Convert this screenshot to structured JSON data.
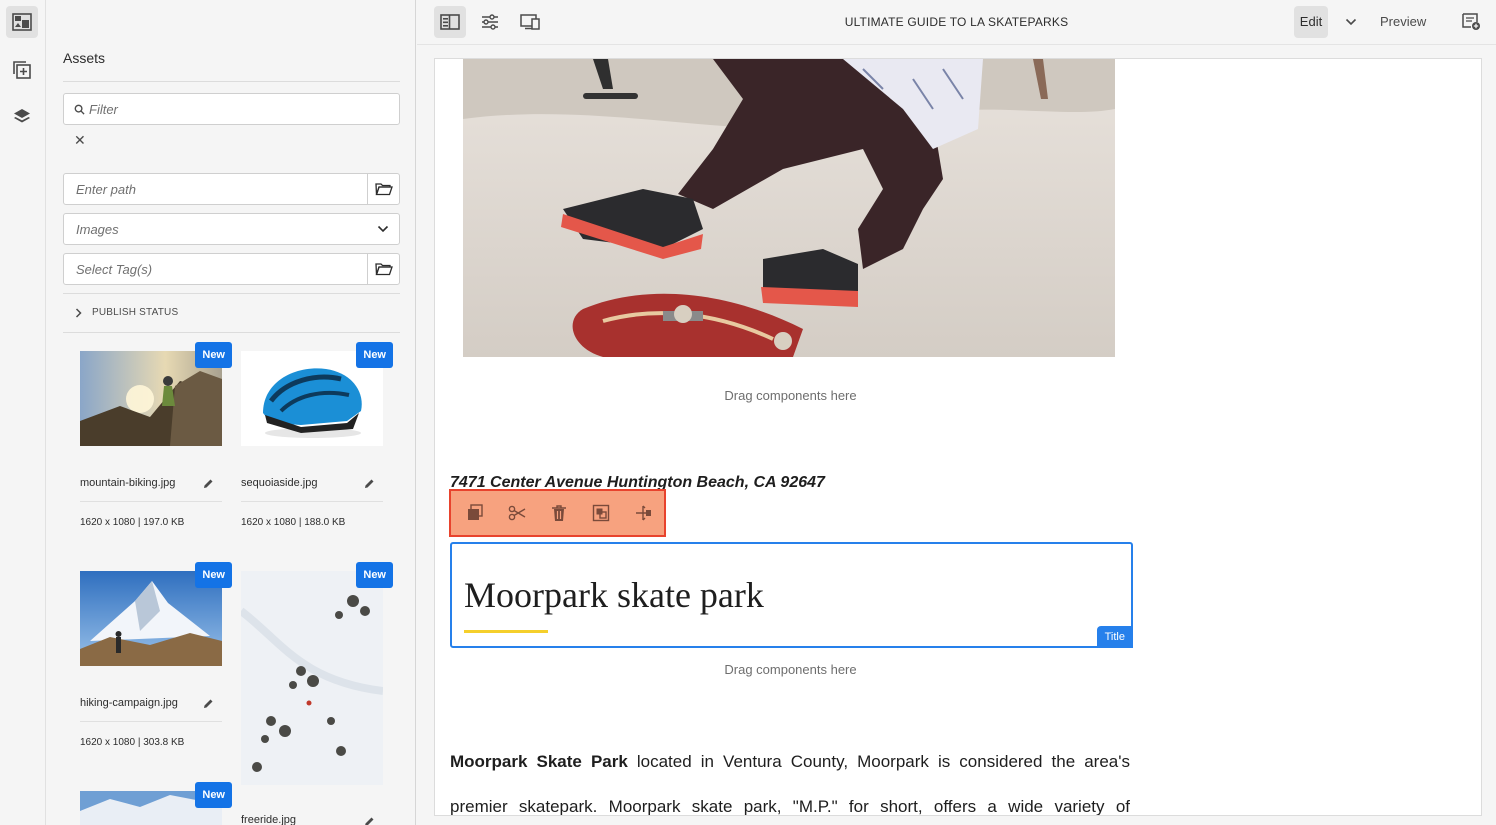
{
  "rail": {
    "icons": [
      "assets-icon",
      "components-icon",
      "layers-icon"
    ]
  },
  "assets_panel": {
    "title": "Assets",
    "filter_placeholder": "Filter",
    "path_placeholder": "Enter path",
    "type_select": "Images",
    "tags_placeholder": "Select Tag(s)",
    "publish_status": "PUBLISH STATUS",
    "items": [
      {
        "name": "mountain-biking.jpg",
        "meta": "1620 x 1080 | 197.0 KB",
        "badge": "New"
      },
      {
        "name": "sequoiaside.jpg",
        "meta": "1620 x 1080 | 188.0 KB",
        "badge": "New"
      },
      {
        "name": "hiking-campaign.jpg",
        "meta": "1620 x 1080 | 303.8 KB",
        "badge": "New"
      },
      {
        "name": "freeride.jpg",
        "meta": "",
        "badge": "New"
      },
      {
        "name": "",
        "meta": "",
        "badge": "New"
      }
    ]
  },
  "toolbar": {
    "page_title": "ULTIMATE GUIDE TO LA SKATEPARKS",
    "mode": "Edit",
    "preview": "Preview"
  },
  "page": {
    "drop_hint_1": "Drag components here",
    "address": "7471 Center Avenue Huntington Beach, CA 92647",
    "title_component": "Moorpark skate park",
    "title_tag": "Title",
    "drop_hint_2": "Drag components here",
    "body_strong": "Moorpark Skate Park",
    "body_line_1": " located in Ventura County, Moorpark is considered the area's",
    "body_line_2": "premier skatepark. Moorpark skate park, \"M.P.\" for short, offers a wide variety of"
  },
  "colors": {
    "accent": "#1473e6",
    "selection_border": "#2680eb",
    "highlight_fill": "#f7a27f",
    "highlight_border": "#e8432d",
    "title_underline": "#f5cf2b"
  }
}
